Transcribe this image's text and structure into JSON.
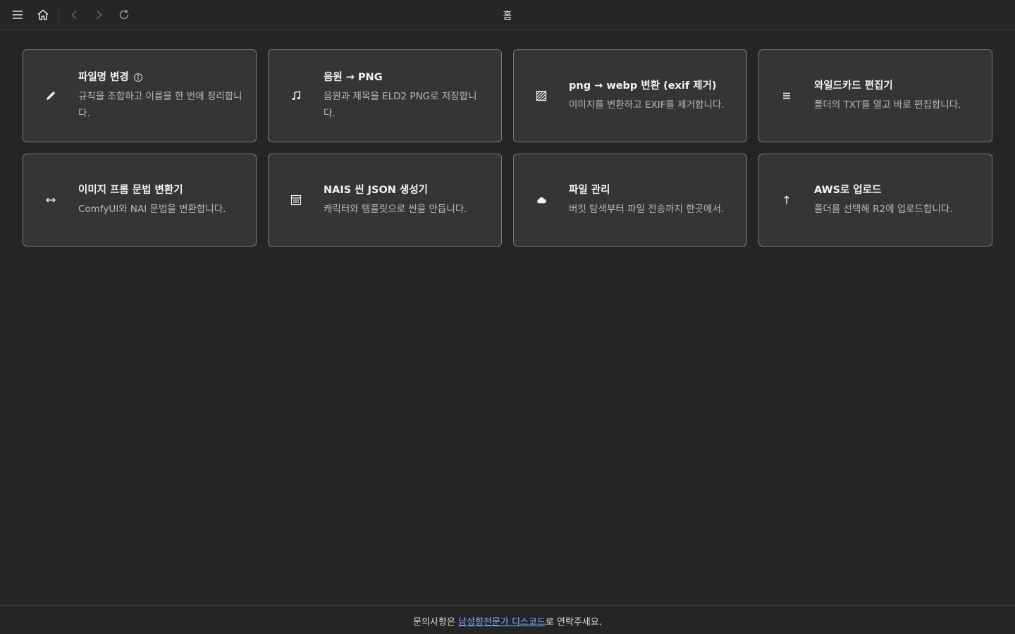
{
  "titlebar": {
    "title": "홈",
    "buttons": [
      {
        "name": "menu-icon"
      },
      {
        "name": "home-icon"
      },
      {
        "name": "back-icon"
      },
      {
        "name": "forward-icon"
      },
      {
        "name": "refresh-icon"
      }
    ]
  },
  "cards": [
    {
      "title": "파일명 변경",
      "desc": "규칙을 조합하고 이름을 한 번에 정리합니다.",
      "icon": "pencil-icon",
      "has_info": true
    },
    {
      "title": "음원 → PNG",
      "desc": "음원과 제목을 ELD2 PNG로 저장합니다.",
      "icon": "music-note-icon"
    },
    {
      "title": "png → webp 변환 (exif 제거)",
      "desc": "이미지를 변환하고 EXIF를 제거합니다.",
      "icon": "image-hatched-icon"
    },
    {
      "title": "와일드카드 편집기",
      "desc": "폴더의 TXT를 열고 바로 편집합니다.",
      "icon": "list-lines-icon"
    },
    {
      "title": "이미지 프롬 문법 변환기",
      "desc": "ComfyUI와 NAI 문법을 변환합니다.",
      "icon": "double-arrow-icon"
    },
    {
      "title": "NAIS 씬 JSON 생성기",
      "desc": "캐릭터와 템플릿으로 씬을 만듭니다.",
      "icon": "document-lines-icon"
    },
    {
      "title": "파일 관리",
      "desc": "버킷 탐색부터 파일 전송까지 한곳에서.",
      "icon": "cloud-icon"
    },
    {
      "title": "AWS로 업로드",
      "desc": "폴더를 선택해 R2에 업로드합니다.",
      "icon": "arrow-up-icon"
    }
  ],
  "footer": {
    "prefix": "문의사항은 ",
    "link": "남성향전문가 디스코드",
    "suffix": "로 연락주세요."
  },
  "colors": {
    "background": "#252525",
    "card": "#353535",
    "card_border": "#7a7a7a",
    "link": "#7fb0ff"
  }
}
